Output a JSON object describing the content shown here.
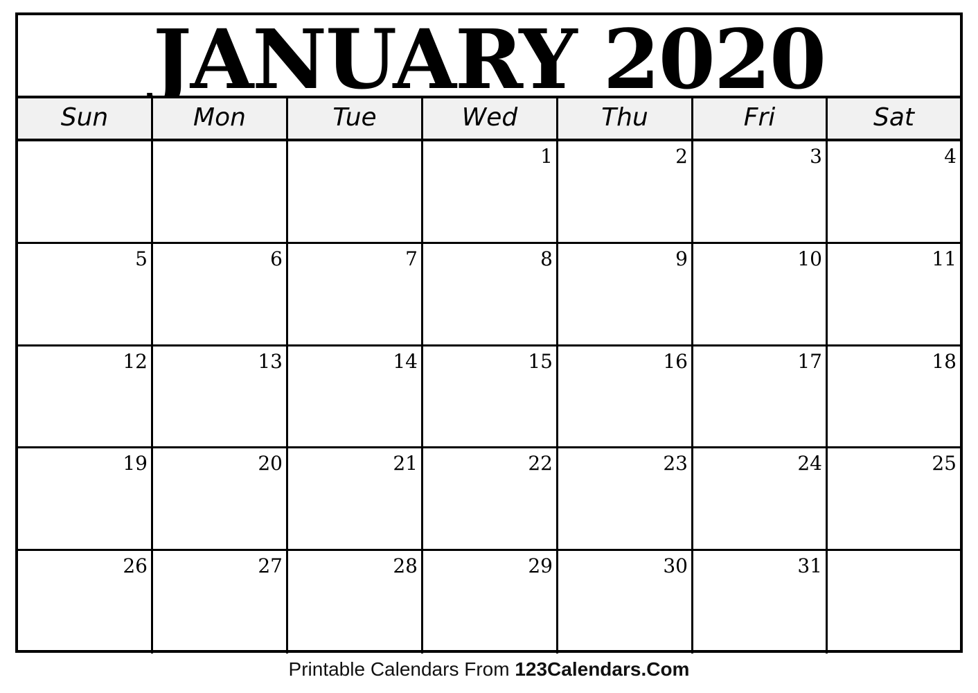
{
  "calendar": {
    "title": "JANUARY 2020",
    "weekdays": [
      "Sun",
      "Mon",
      "Tue",
      "Wed",
      "Thu",
      "Fri",
      "Sat"
    ],
    "weeks": [
      [
        "",
        "",
        "",
        "1",
        "2",
        "3",
        "4"
      ],
      [
        "5",
        "6",
        "7",
        "8",
        "9",
        "10",
        "11"
      ],
      [
        "12",
        "13",
        "14",
        "15",
        "16",
        "17",
        "18"
      ],
      [
        "19",
        "20",
        "21",
        "22",
        "23",
        "24",
        "25"
      ],
      [
        "26",
        "27",
        "28",
        "29",
        "30",
        "31",
        ""
      ]
    ]
  },
  "footer": {
    "prefix": "Printable Calendars From ",
    "site": "123Calendars.Com"
  }
}
